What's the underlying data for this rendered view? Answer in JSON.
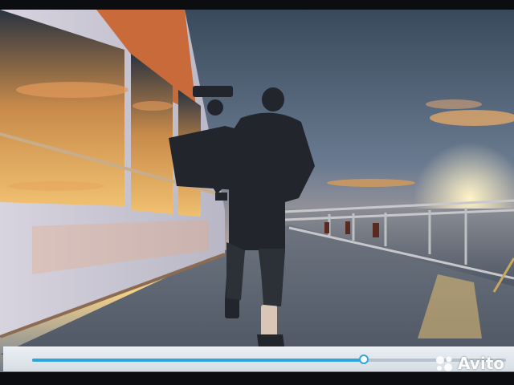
{
  "player": {
    "progress_fraction": 0.7,
    "accent_color": "#2fa6d8"
  },
  "watermark": {
    "text": "Avito",
    "icon": "avito-dots-icon"
  },
  "icons": [
    "seek-thumb-icon",
    "avito-dots-icon"
  ]
}
